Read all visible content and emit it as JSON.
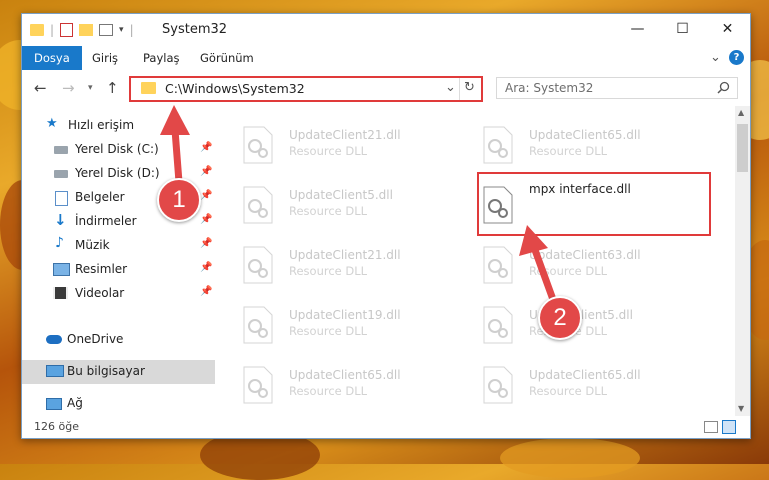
{
  "colors": {
    "accent": "#1979ca",
    "annotation": "#e03a3a",
    "badge": "#e24848",
    "folder": "#ffd35b"
  },
  "window": {
    "title": "System32",
    "controls": {
      "minimize": "—",
      "maximize": "☐",
      "close": "✕"
    }
  },
  "ribbon": {
    "tabs": [
      "Dosya",
      "Giriş",
      "Paylaş",
      "Görünüm"
    ],
    "chevron": "⌄",
    "help": "?"
  },
  "address": {
    "path": "C:\\Windows\\System32",
    "search_placeholder": "Ara: System32"
  },
  "sidebar": {
    "items": [
      {
        "label": "Hızlı erişim",
        "icon": "star-icon"
      },
      {
        "label": "Yerel Disk (C:)",
        "icon": "drive-icon"
      },
      {
        "label": "Yerel Disk (D:)",
        "icon": "drive-icon"
      },
      {
        "label": "Belgeler",
        "icon": "documents-icon"
      },
      {
        "label": "İndirmeler",
        "icon": "download-icon"
      },
      {
        "label": "Müzik",
        "icon": "music-icon"
      },
      {
        "label": "Resimler",
        "icon": "pictures-icon"
      },
      {
        "label": "Videolar",
        "icon": "videos-icon"
      },
      {
        "label": "OneDrive",
        "icon": "cloud-icon"
      },
      {
        "label": "Bu bilgisayar",
        "icon": "computer-icon"
      },
      {
        "label": "Ağ",
        "icon": "network-icon"
      }
    ]
  },
  "files": [
    {
      "name": "UpdateClient21.dll",
      "type": "Resource DLL"
    },
    {
      "name": "UpdateClient65.dll",
      "type": "Resource DLL"
    },
    {
      "name": "UpdateClient5.dll",
      "type": "Resource DLL"
    },
    {
      "name": "mpx interface.dll",
      "type": ""
    },
    {
      "name": "UpdateClient21.dll",
      "type": "Resource DLL"
    },
    {
      "name": "UpdateClient63.dll",
      "type": "Resource DLL"
    },
    {
      "name": "UpdateClient19.dll",
      "type": "Resource DLL"
    },
    {
      "name": "UpdateClient5.dll",
      "type": "Resource DLL"
    },
    {
      "name": "UpdateClient65.dll",
      "type": "Resource DLL"
    },
    {
      "name": "UpdateClient65.dll",
      "type": "Resource DLL"
    }
  ],
  "status": {
    "count": "126 öğe"
  },
  "annotations": {
    "step1": "1",
    "step2": "2"
  }
}
